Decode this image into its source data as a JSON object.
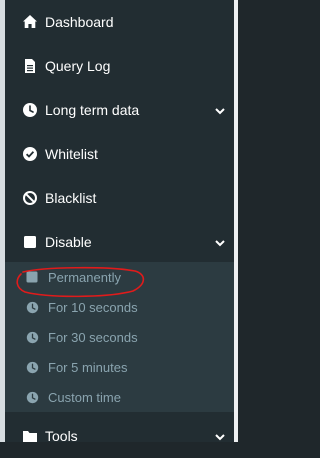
{
  "menu": {
    "items": [
      {
        "label": "Dashboard",
        "icon": "home-icon"
      },
      {
        "label": "Query Log",
        "icon": "file-icon"
      },
      {
        "label": "Long term data",
        "icon": "clock-icon",
        "expandable": true
      },
      {
        "label": "Whitelist",
        "icon": "check-circle-icon"
      },
      {
        "label": "Blacklist",
        "icon": "ban-icon"
      },
      {
        "label": "Disable",
        "icon": "stop-square-icon",
        "expandable": true,
        "expanded": true
      },
      {
        "label": "Tools",
        "icon": "folder-icon",
        "expandable": true
      }
    ],
    "disable_submenu": [
      {
        "label": "Permanently",
        "icon": "stop-square-icon"
      },
      {
        "label": "For 10 seconds",
        "icon": "clock-icon"
      },
      {
        "label": "For 30 seconds",
        "icon": "clock-icon"
      },
      {
        "label": "For 5 minutes",
        "icon": "clock-icon"
      },
      {
        "label": "Custom time",
        "icon": "clock-icon"
      }
    ]
  },
  "colors": {
    "sidebar_bg": "#222d32",
    "submenu_bg": "#2c3b41",
    "text": "#ffffff",
    "submenu_text": "#8aa4af",
    "annotation": "#e01b1b"
  }
}
